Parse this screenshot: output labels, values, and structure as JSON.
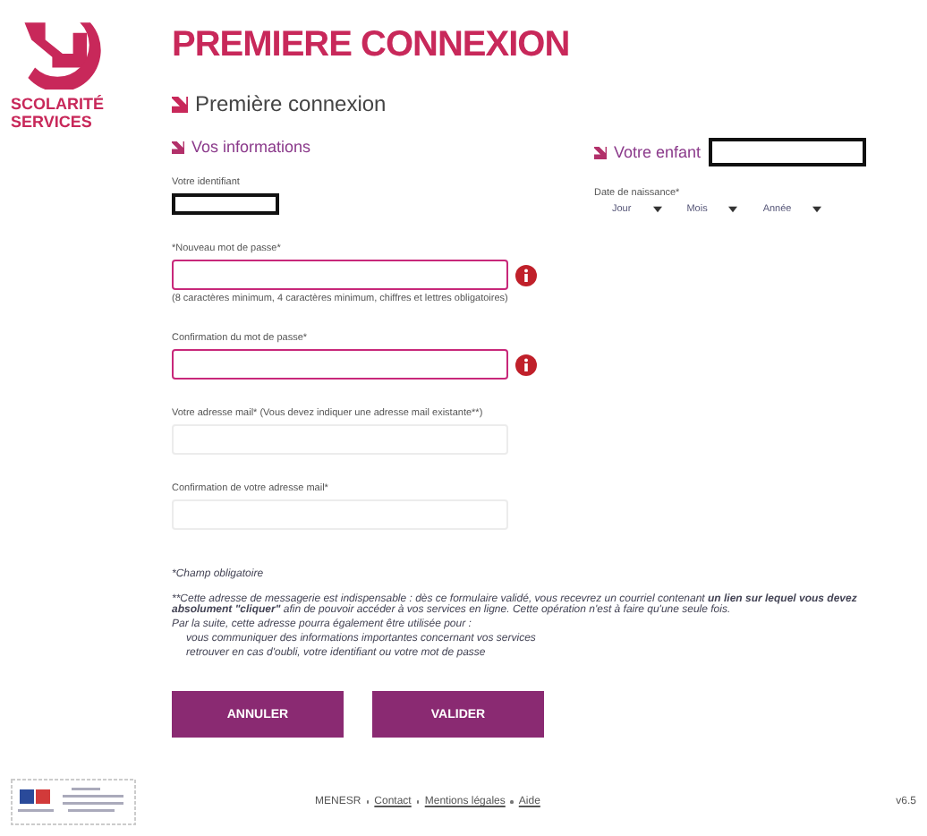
{
  "logo": {
    "lines": [
      "SCOLARITÉ",
      "SERVICES"
    ]
  },
  "title": "PREMIERE CONNEXION",
  "subtitle": "Première connexion",
  "left_section": {
    "heading": "Vos informations",
    "fields": [
      {
        "kind": "redacted",
        "label": "Votre identifiant"
      },
      {
        "kind": "input",
        "label": "*Nouveau mot de passe*",
        "error": true,
        "hint": "(8 caractères minimum, 4 caractères minimum, chiffres et lettres obligatoires)"
      },
      {
        "kind": "input",
        "label": "Confirmation du mot de passe*",
        "error": true
      },
      {
        "kind": "input",
        "label": "Votre adresse mail* (Vous devez indiquer une adresse mail existante**)",
        "error": false
      },
      {
        "kind": "input",
        "label": "Confirmation de votre adresse mail*",
        "error": false
      }
    ]
  },
  "right_section": {
    "heading": "Votre enfant",
    "birth_label": "Date de naissance*",
    "selects": [
      {
        "placeholder": "Jour"
      },
      {
        "placeholder": "Mois"
      },
      {
        "placeholder": "Année"
      }
    ]
  },
  "notes": {
    "required": "*Champ obligatoire",
    "paragraph_mark": "**",
    "paragraph": "Cette adresse de messagerie est indispensable : dès ce formulaire validé, vous recevrez un courriel contenant **un lien sur lequel vous devez absolument \"cliquer\"** afin de pouvoir accéder à vos services en ligne. Cette opération n'est à faire qu'une seule fois.",
    "followup": "Par la suite, cette adresse pourra également être utilisée pour :",
    "items": [
      "vous communiquer des informations importantes concernant vos services",
      "retrouver en cas d'oubli, votre identifiant ou votre mot de passe"
    ]
  },
  "buttons": [
    "ANNULER",
    "VALIDER"
  ],
  "footer": {
    "links": [
      {
        "label": "MENESR",
        "link": false
      },
      {
        "label": "Contact",
        "link": true
      },
      {
        "label": "Mentions légales",
        "link": true
      },
      {
        "label": "Aide",
        "link": true
      }
    ],
    "version": "v6.5"
  }
}
